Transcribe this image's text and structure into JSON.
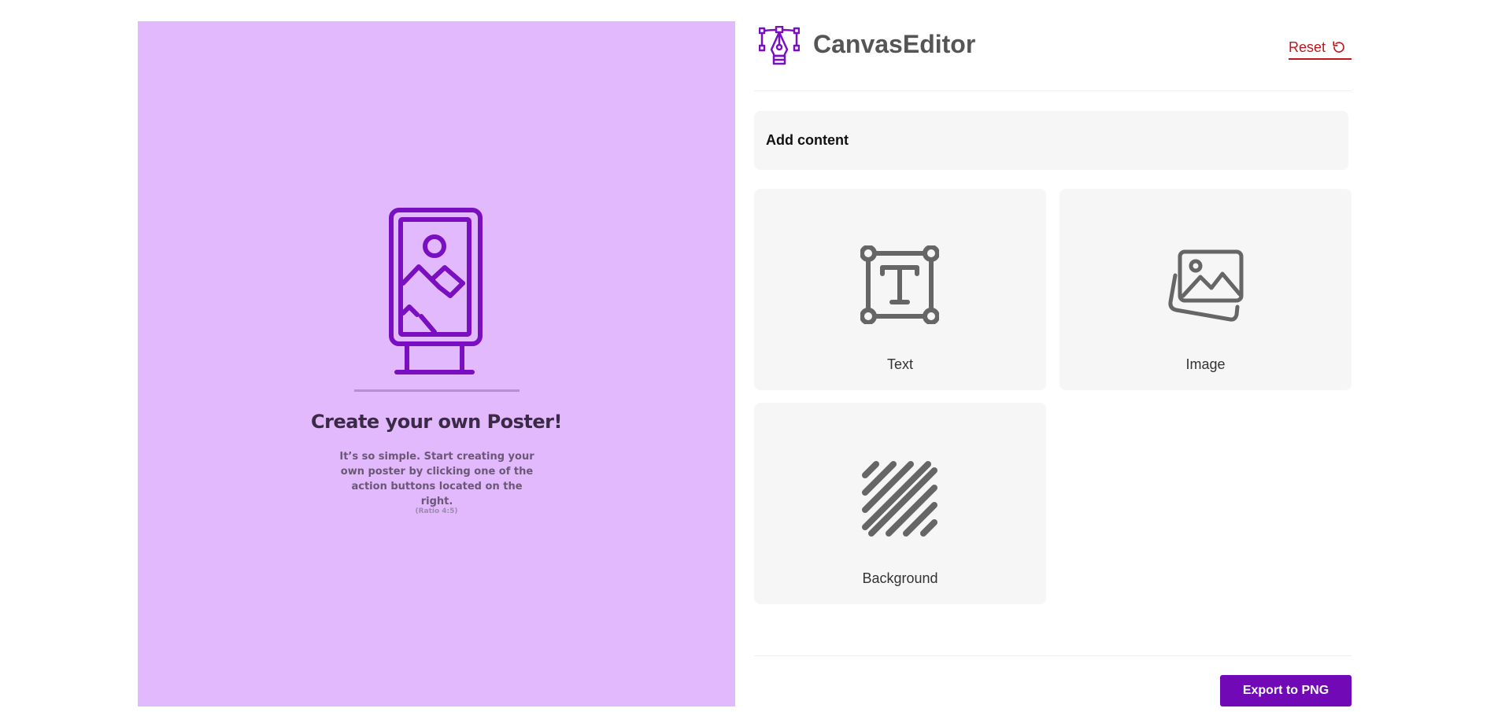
{
  "canvas": {
    "background_color": "#e1b9fc",
    "icon": "poster-stand-icon",
    "title": "Create your own Poster!",
    "description": "It’s so simple. Start creating your own poster by clicking one of the action buttons located on the right.",
    "ratio": "(Ratio 4:5)"
  },
  "header": {
    "logo_icon": "pen-tool-icon",
    "app_title": "CanvasEditor",
    "reset_label": "Reset",
    "reset_icon": "rotate-ccw-icon"
  },
  "panel": {
    "section_title": "Add content",
    "tiles": [
      {
        "label": "Text",
        "icon": "text-box-icon"
      },
      {
        "label": "Image",
        "icon": "images-icon"
      },
      {
        "label": "Background",
        "icon": "stripes-icon"
      }
    ]
  },
  "footer": {
    "export_label": "Export to PNG"
  },
  "colors": {
    "accent": "#7209b7",
    "danger": "#c0151c",
    "tile_bg": "#f6f6f6",
    "icon_gray": "#666666"
  }
}
